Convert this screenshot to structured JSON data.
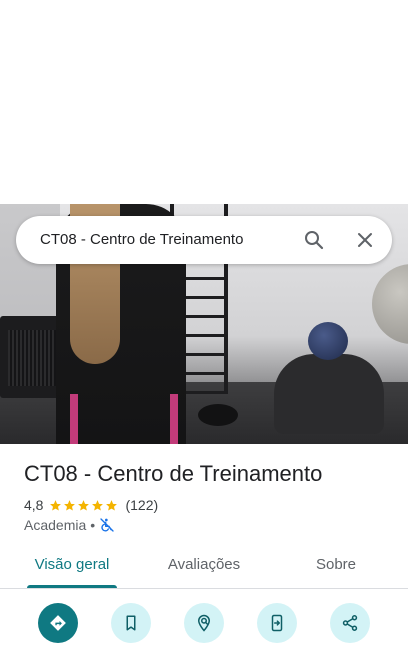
{
  "search": {
    "query": "CT08 - Centro de Treinamento"
  },
  "place": {
    "title": "CT08 - Centro de Treinamento",
    "rating_value": "4,8",
    "stars": 5,
    "review_count": "(122)",
    "category": "Academia",
    "separator": "•"
  },
  "tabs": [
    {
      "label": "Visão geral",
      "active": true
    },
    {
      "label": "Avaliações",
      "active": false
    },
    {
      "label": "Sobre",
      "active": false
    }
  ],
  "actions": [
    {
      "icon": "directions-icon",
      "primary": true
    },
    {
      "icon": "bookmark-icon",
      "primary": false
    },
    {
      "icon": "nearby-icon",
      "primary": false
    },
    {
      "icon": "send-to-phone-icon",
      "primary": false
    },
    {
      "icon": "share-icon",
      "primary": false
    }
  ],
  "colors": {
    "accent": "#0f7982",
    "accent_light": "#d3f3f6",
    "star": "#f4b400",
    "accessibility_icon": "#1a73e8"
  }
}
